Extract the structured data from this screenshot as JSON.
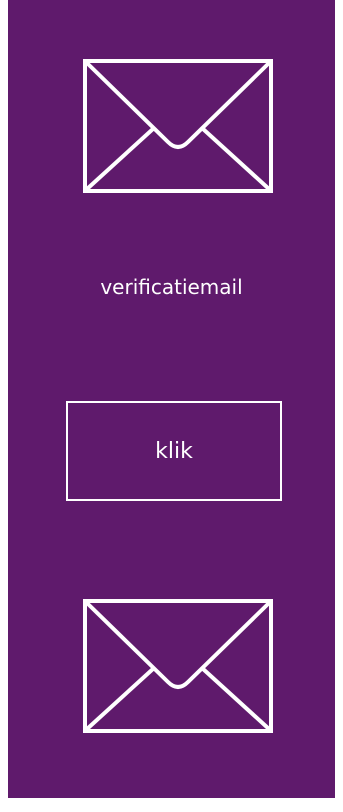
{
  "colors": {
    "panel_background": "#5f1a6c",
    "foreground": "#ffffff",
    "page_background": "#ffffff"
  },
  "icons": {
    "top": "envelope-icon",
    "bottom": "envelope-icon"
  },
  "content": {
    "caption": "verificatiemail",
    "button_label": "klik"
  }
}
